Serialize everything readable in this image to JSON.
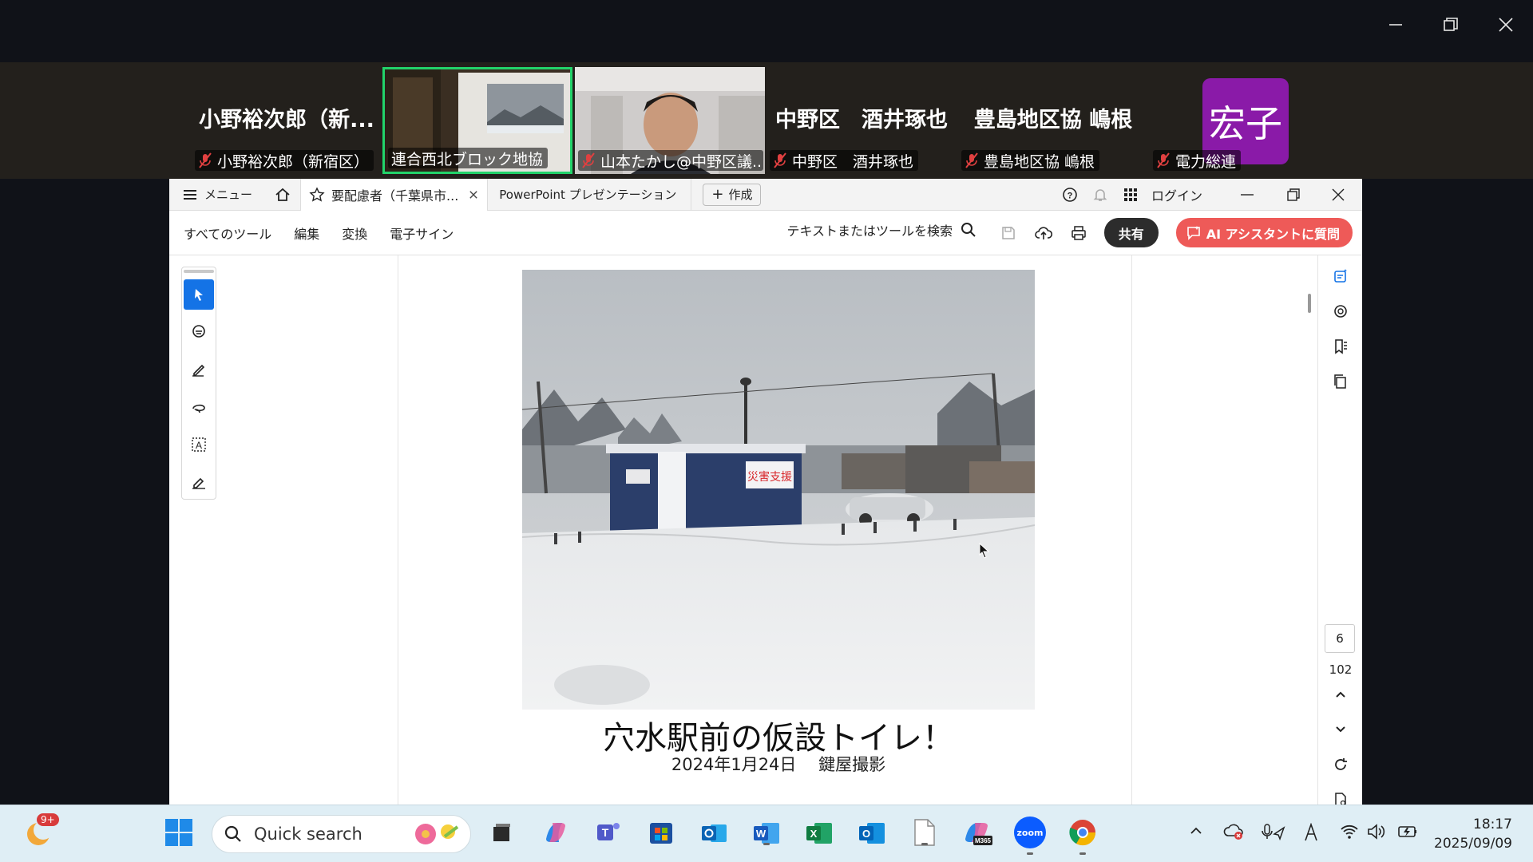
{
  "zoom": {
    "participants": [
      {
        "big_name": "小野裕次郎（新...",
        "tag": "小野裕次郎（新宿区）"
      },
      {
        "big_name": "",
        "tag": "連合西北ブロック地協"
      },
      {
        "big_name": "",
        "tag": "山本たかし@中野区議..."
      },
      {
        "big_name": "中野区　酒井琢也",
        "tag": "中野区　酒井琢也"
      },
      {
        "big_name": "豊島地区協 嶋根",
        "tag": "豊島地区協 嶋根"
      },
      {
        "avatar_text": "宏子",
        "tag": "電力総連"
      }
    ]
  },
  "acrobat": {
    "menu_label": "メニュー",
    "tab1_label": "要配慮者（千葉県市...",
    "tab2_label": "PowerPoint プレゼンテーション",
    "create_label": "作成",
    "login_label": "ログイン",
    "tools": {
      "all_tools": "すべてのツール",
      "edit": "編集",
      "convert": "変換",
      "esign": "電子サイン"
    },
    "search_label": "テキストまたはツールを検索",
    "share_label": "共有",
    "ai_label": "AI アシスタントに質問",
    "page_current": "6",
    "page_total": "102"
  },
  "slide": {
    "title": "穴水駅前の仮設トイレ！",
    "subtitle": "2024年1月24日　 鍵屋撮影",
    "booth_sign": "災害支援"
  },
  "taskbar": {
    "badge": "9+",
    "search_placeholder": "Quick search",
    "time": "18:17",
    "date": "2025/09/09",
    "m365_label": "M365",
    "zoom_label": "zoom"
  }
}
